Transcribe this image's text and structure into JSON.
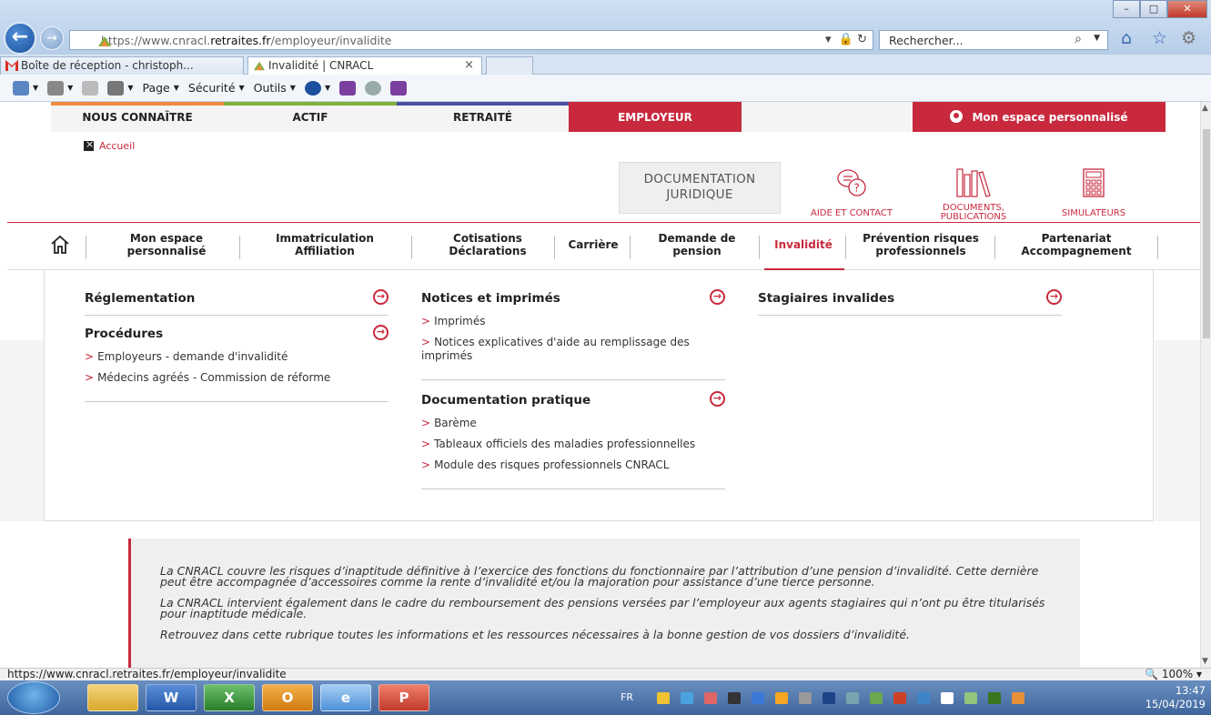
{
  "browser": {
    "url_prefix": "https://www.cnracl.",
    "url_domain": "retraites.fr",
    "url_path": "/employeur/invalidite",
    "search_placeholder": "Rechercher...",
    "tabs": [
      {
        "label": "Boîte de réception - christoph..."
      },
      {
        "label": "Invalidité | CNRACL"
      }
    ],
    "tab_close": "×",
    "commands": [
      "Page",
      "Sécurité",
      "Outils"
    ],
    "status_url": "https://www.cnracl.retraites.fr/employeur/invalidite",
    "zoom": "100%"
  },
  "topnav": {
    "connaitre": "NOUS CONNAÎTRE",
    "actif": "ACTIF",
    "retraite": "RETRAITÉ",
    "employeur": "EMPLOYEUR",
    "espace": "Mon espace personnalisé"
  },
  "breadcrumb": "Accueil",
  "header": {
    "doc_line1": "DOCUMENTATION",
    "doc_line2": "JURIDIQUE",
    "aide": "AIDE ET CONTACT",
    "docs_line1": "DOCUMENTS,",
    "docs_line2": "PUBLICATIONS",
    "simulateurs": "SIMULATEURS"
  },
  "mainnav": [
    {
      "l1": "Mon espace",
      "l2": "personnalisé"
    },
    {
      "l1": "Immatriculation",
      "l2": "Affiliation"
    },
    {
      "l1": "Cotisations",
      "l2": "Déclarations"
    },
    {
      "l1": "Carrière",
      "l2": ""
    },
    {
      "l1": "Demande de",
      "l2": "pension"
    },
    {
      "l1": "Invalidité",
      "l2": ""
    },
    {
      "l1": "Prévention risques",
      "l2": "professionnels"
    },
    {
      "l1": "Partenariat",
      "l2": "Accompagnement"
    }
  ],
  "megamenu": {
    "reglementation": "Réglementation",
    "procedures": "Procédures",
    "procedures_links": [
      "Employeurs - demande d'invalidité",
      "Médecins agréés - Commission de réforme"
    ],
    "notices": "Notices et imprimés",
    "notices_links": [
      "Imprimés",
      "Notices explicatives d'aide au remplissage des imprimés"
    ],
    "doc_pratique": "Documentation pratique",
    "doc_links": [
      "Barème",
      "Tableaux officiels des maladies professionnelles",
      "Module des risques professionnels CNRACL"
    ],
    "stagiaires": "Stagiaires invalides",
    "arrow": "→",
    "bullet": ">"
  },
  "intro": [
    "La CNRACL couvre les risques d’inaptitude définitive à l’exercice des fonctions du fonctionnaire par l’attribution d’une pension d’invalidité. Cette dernière peut être accompagnée d’accessoires comme la rente d’invalidité et/ou la majoration pour assistance d’une tierce personne.",
    "La CNRACL intervient également dans le cadre du remboursement des pensions versées par l’employeur aux agents stagiaires qui n’ont pu être titularisés pour inaptitude médicale.",
    "Retrouvez dans cette rubrique toutes les informations et les ressources nécessaires à la bonne gestion de vos dossiers d’invalidité."
  ],
  "taskbar": {
    "lang": "FR",
    "time": "13:47",
    "date": "15/04/2019",
    "apps": [
      "W",
      "X",
      "O",
      "e",
      "P"
    ]
  },
  "colors": {
    "brand_red": "#c8293d",
    "orange": "#f08a3c",
    "green": "#7fb13c",
    "purple": "#4b4f9e"
  }
}
